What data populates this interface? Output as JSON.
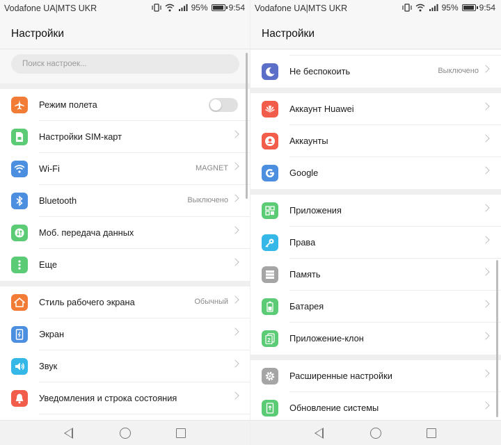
{
  "status": {
    "carrier": "Vodafone UA|MTS UKR",
    "battery": "95%",
    "time": "9:54"
  },
  "title": "Настройки",
  "search": {
    "placeholder": "Поиск настроек..."
  },
  "left": {
    "group1": [
      {
        "label": "Режим полета",
        "icon": "airplane-icon",
        "color": "#f27b35",
        "control": "toggle",
        "toggle_on": false
      },
      {
        "label": "Настройки SIM-карт",
        "icon": "sim-icon",
        "color": "#5ccb76"
      },
      {
        "label": "Wi-Fi",
        "icon": "wifi-icon",
        "color": "#4c8fe0",
        "value": "MAGNET"
      },
      {
        "label": "Bluetooth",
        "icon": "bluetooth-icon",
        "color": "#4c8fe0",
        "value": "Выключено"
      },
      {
        "label": "Моб. передача данных",
        "icon": "mobile-data-icon",
        "color": "#5ccb76"
      },
      {
        "label": "Еще",
        "icon": "more-icon",
        "color": "#5ccb76"
      }
    ],
    "group2": [
      {
        "label": "Стиль рабочего экрана",
        "icon": "home-icon",
        "color": "#f27b35",
        "value": "Обычный"
      },
      {
        "label": "Экран",
        "icon": "display-icon",
        "color": "#4c8fe0"
      },
      {
        "label": "Звук",
        "icon": "sound-icon",
        "color": "#35b8e8"
      },
      {
        "label": "Уведомления и строка состояния",
        "icon": "bell-icon",
        "color": "#f25c4a"
      }
    ]
  },
  "right": {
    "group0": [
      {
        "label": "Не беспокоить",
        "icon": "moon-icon",
        "color": "#5b6ec8",
        "value": "Выключено"
      }
    ],
    "group1": [
      {
        "label": "Аккаунт Huawei",
        "icon": "huawei-icon",
        "color": "#f25c4a"
      },
      {
        "label": "Аккаунты",
        "icon": "account-icon",
        "color": "#f25c4a"
      },
      {
        "label": "Google",
        "icon": "google-icon",
        "color": "#4c8fe0"
      }
    ],
    "group2": [
      {
        "label": "Приложения",
        "icon": "apps-icon",
        "color": "#5ccb76"
      },
      {
        "label": "Права",
        "icon": "key-icon",
        "color": "#35b8e8"
      },
      {
        "label": "Память",
        "icon": "storage-icon",
        "color": "#a5a5a5"
      },
      {
        "label": "Батарея",
        "icon": "battery-icon",
        "color": "#5ccb76"
      },
      {
        "label": "Приложение-клон",
        "icon": "app-clone-icon",
        "color": "#5ccb76"
      }
    ],
    "group3": [
      {
        "label": "Расширенные настройки",
        "icon": "gear-icon",
        "color": "#a5a5a5"
      },
      {
        "label": "Обновление системы",
        "icon": "system-update-icon",
        "color": "#5ccb76"
      }
    ]
  }
}
